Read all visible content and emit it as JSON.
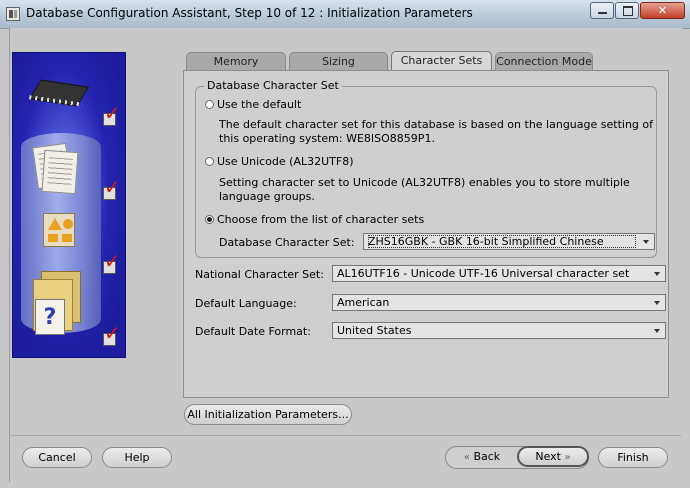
{
  "window": {
    "title": "Database Configuration Assistant, Step 10 of 12 : Initialization Parameters"
  },
  "tabs": [
    {
      "label": "Memory",
      "active": false
    },
    {
      "label": "Sizing",
      "active": false
    },
    {
      "label": "Character Sets",
      "active": true
    },
    {
      "label": "Connection Mode",
      "active": false
    }
  ],
  "db_charset_group": {
    "legend": "Database Character Set",
    "option_default": {
      "label": "Use the default",
      "selected": false,
      "description": "The default character set for this database is based on the language setting of this operating system: WE8ISO8859P1."
    },
    "option_unicode": {
      "label": "Use Unicode (AL32UTF8)",
      "selected": false,
      "description": "Setting character set to Unicode (AL32UTF8) enables you to store multiple language groups."
    },
    "option_list": {
      "label": "Choose from the list of character sets",
      "selected": true
    },
    "charset_field": {
      "label": "Database Character Set:",
      "value": "ZHS16GBK - GBK 16-bit Simplified Chinese"
    }
  },
  "national_charset": {
    "label": "National Character Set:",
    "value": "AL16UTF16 - Unicode UTF-16 Universal character set"
  },
  "default_language": {
    "label": "Default Language:",
    "value": "American"
  },
  "default_date_format": {
    "label": "Default Date Format:",
    "value": "United States"
  },
  "buttons": {
    "all_params": "All Initialization Parameters...",
    "cancel": "Cancel",
    "help": "Help",
    "back": "Back",
    "next": "Next",
    "finish": "Finish"
  },
  "colors": {
    "art_background": "#1c1c9c",
    "checkmark": "#d01818",
    "active_tab": "#d8d8d8",
    "inactive_tab": "#a9a9a9"
  }
}
